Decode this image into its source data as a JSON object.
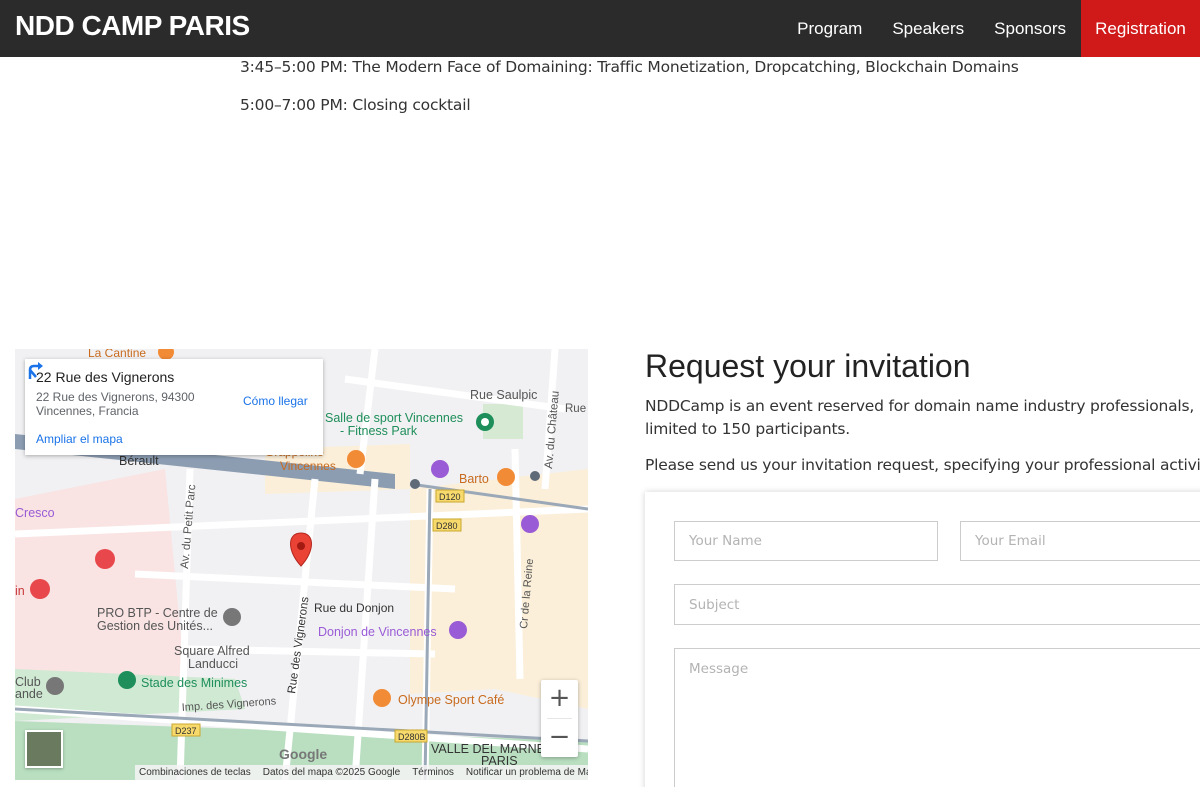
{
  "header": {
    "brand": "NDD CAMP PARIS",
    "nav": [
      {
        "label": "Program"
      },
      {
        "label": "Speakers"
      },
      {
        "label": "Sponsors"
      },
      {
        "label": "Registration",
        "active": true
      }
    ],
    "accent_color": "#d01919"
  },
  "schedule": [
    "3:45–5:00 PM: The Modern Face of Domaining: Traffic Monetization, Dropcatching, Blockchain Domains",
    "5:00–7:00 PM: Closing cocktail"
  ],
  "map": {
    "card": {
      "title": "22 Rue des Vignerons",
      "address_line1": "22 Rue des Vignerons, 94300",
      "address_line2": "Vincennes, Francia",
      "directions_label": "Cómo llegar",
      "enlarge_label": "Ampliar el mapa"
    },
    "labels": {
      "la_cantine": "La Cantine",
      "rue_saulpic": "Rue Saulpic",
      "salle_sport_1": "Salle de sport Vincennes",
      "salle_sport_2": "- Fitness Park",
      "berault": "Bérault",
      "grappo_1": "Grappolino",
      "grappo_2": "Vincennes",
      "barto": "Barto",
      "av_chateau": "Av. du Château",
      "rue_short": "Rue",
      "cresco": "Cresco",
      "d120": "D120",
      "d280": "D280",
      "av_petit_parc": "Av. du Petit Parc",
      "pro_btp_1": "PRO BTP - Centre de",
      "pro_btp_2": "Gestion des Unités...",
      "rue_donjon": "Rue du Donjon",
      "donjon": "Donjon de Vincennes",
      "cr_reine": "Cr de la Reine",
      "square_1": "Square Alfred",
      "square_2": "Landucci",
      "rue_vignerons": "Rue des Vignerons",
      "club_1": "Club",
      "club_2": "ande",
      "stade": "Stade des Minimes",
      "imp_vignerons": "Imp. des Vignerons",
      "olympe": "Olympe Sport Café",
      "d237": "D237",
      "d280b": "D280B",
      "valle_1": "VALLE DEL MARNE",
      "valle_2": "PARIS",
      "left_edge": "in"
    },
    "zoom_in": "+",
    "zoom_out": "−",
    "google": "Google",
    "attribution": [
      "Combinaciones de teclas",
      "Datos del mapa ©2025 Google",
      "Términos",
      "Notificar un problema de Maps"
    ],
    "marker_color": "#ea4335"
  },
  "invitation": {
    "title": "Request your invitation",
    "description": "NDDCamp is an event reserved for domain name industry professionals, limited to 150 participants.",
    "note": "Please send us your invitation request, specifying your professional activity.",
    "fields": {
      "name_placeholder": "Your Name",
      "email_placeholder": "Your Email",
      "subject_placeholder": "Subject",
      "message_placeholder": "Message"
    }
  }
}
